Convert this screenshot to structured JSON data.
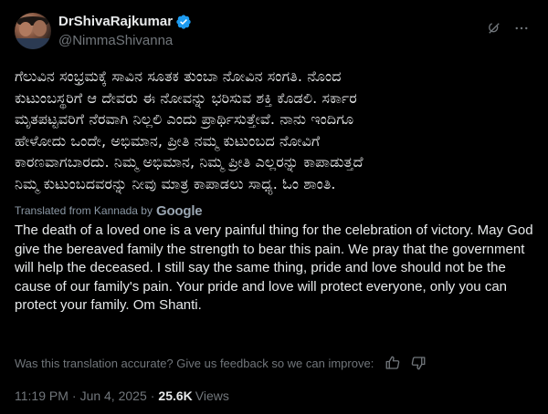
{
  "author": {
    "display_name": "DrShivaRajkumar",
    "handle": "@NimmaShivanna",
    "verified": true
  },
  "icons": {
    "verified": "verified-badge-icon",
    "grok": "grok-icon",
    "more": "more-icon",
    "thumb_up": "thumb-up-icon",
    "thumb_down": "thumb-down-icon"
  },
  "colors": {
    "background": "#000000",
    "text_primary": "#e7e9ea",
    "text_secondary": "#71767b",
    "verified_blue": "#1d9bf0"
  },
  "tweet": {
    "original_text": "ಗೆಲುವಿನ ಸಂಭ್ರಮಕ್ಕೆ ಸಾವಿನ ಸೂತಕ ತುಂಬಾ ನೋವಿನ ಸಂಗತಿ. ನೊಂದ\nಕುಟುಂಬಸ್ಥರಿಗೆ ಆ ದೇವರು ಈ ನೋವನ್ನು ಭರಿಸುವ ಶಕ್ತಿ ಕೊಡಲಿ. ಸರ್ಕಾರ\nಮೃತಪಟ್ಟವರಿಗೆ ನೆರವಾಗಿ ನಿಲ್ಲಲಿ ಎಂದು ಪ್ರಾರ್ಥಿಸುತ್ತೇವೆ. ನಾನು ಇಂದಿಗೂ\nಹೇಳೋದು ಒಂದೇ, ಅಭಿಮಾನ, ಪ್ರೀತಿ ನಮ್ಮ ಕುಟುಂಬದ ನೋವಿಗೆ\nಕಾರಣವಾಗಬಾರದು. ನಿಮ್ಮ ಅಭಿಮಾನ, ನಿಮ್ಮ ಪ್ರೀತಿ ಎಲ್ಲರನ್ನು ಕಾಪಾಡುತ್ತದೆ\nನಿಮ್ಮ ಕುಟುಂಬದವರನ್ನು ನೀವು ಮಾತ್ರ ಕಾಪಾಡಲು ಸಾಧ್ಯ. ಓಂ ಶಾಂತಿ.",
    "translated_by_label": "Translated from Kannada by",
    "translator_brand": "Google",
    "translated_text": "The death of a loved one is a very painful thing for the celebration of victory. May God give the bereaved family the strength to bear this pain. We pray that the government will help the deceased. I still say the same thing, pride and love should not be the cause of our family's pain. Your pride and love will protect everyone, only you can protect your family. Om Shanti.",
    "feedback_prompt": "Was this translation accurate? Give us feedback so we can improve:",
    "time": "11:19 PM",
    "separator": "·",
    "date": "Jun 4, 2025",
    "views_count": "25.6K",
    "views_label": "Views"
  }
}
